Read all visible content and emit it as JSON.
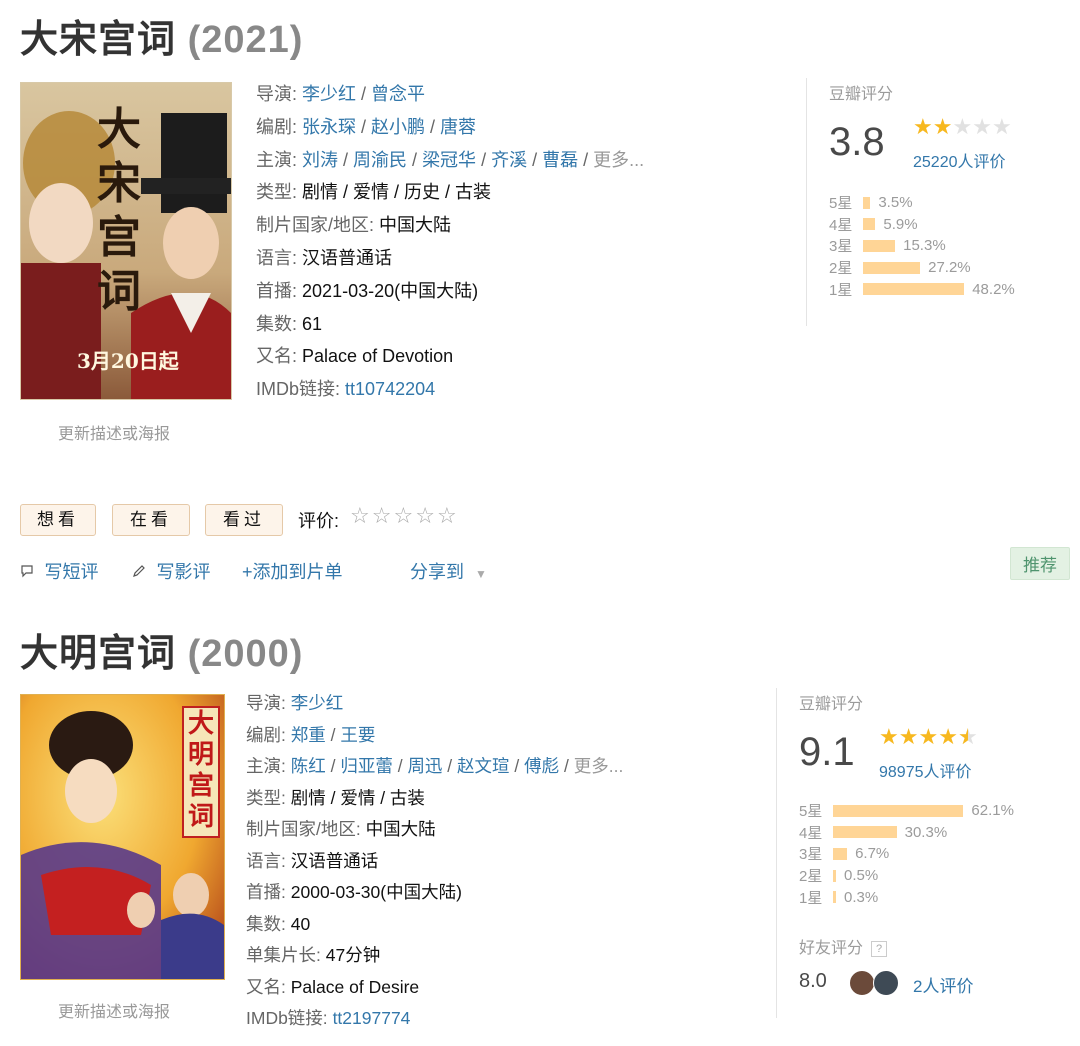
{
  "movies": [
    {
      "title": "大宋宫词",
      "year": "(2021)",
      "poster": {
        "text": "大宋宫词",
        "date": "3月20日起"
      },
      "poster_update": "更新描述或海报",
      "info": {
        "director_label": "导演:",
        "directors": [
          "李少红",
          "曾念平"
        ],
        "writer_label": "编剧:",
        "writers": [
          "张永琛",
          "赵小鹏",
          "唐蓉"
        ],
        "cast_label": "主演:",
        "cast": [
          "刘涛",
          "周渝民",
          "梁冠华",
          "齐溪",
          "曹磊"
        ],
        "more": "更多...",
        "genre_label": "类型:",
        "genre": "剧情 / 爱情 / 历史 / 古装",
        "country_label": "制片国家/地区:",
        "country": "中国大陆",
        "language_label": "语言:",
        "language": "汉语普通话",
        "premiere_label": "首播:",
        "premiere": "2021-03-20(中国大陆)",
        "episodes_label": "集数:",
        "episodes": "61",
        "aka_label": "又名:",
        "aka": "Palace of Devotion",
        "imdb_label": "IMDb链接:",
        "imdb": "tt10742204"
      },
      "rating": {
        "head": "豆瓣评分",
        "score": "3.8",
        "stars_filled": 2,
        "votes": "25220人评价",
        "distribution": [
          {
            "label": "5星",
            "pct": "3.5%",
            "value": 3.5
          },
          {
            "label": "4星",
            "pct": "5.9%",
            "value": 5.9
          },
          {
            "label": "3星",
            "pct": "15.3%",
            "value": 15.3
          },
          {
            "label": "2星",
            "pct": "27.2%",
            "value": 27.2
          },
          {
            "label": "1星",
            "pct": "48.2%",
            "value": 48.2
          }
        ]
      }
    },
    {
      "title": "大明宫词",
      "year": "(2000)",
      "poster": {
        "text": "大明宫词"
      },
      "poster_update": "更新描述或海报",
      "info": {
        "director_label": "导演:",
        "directors": [
          "李少红"
        ],
        "writer_label": "编剧:",
        "writers": [
          "郑重",
          "王要"
        ],
        "cast_label": "主演:",
        "cast": [
          "陈红",
          "归亚蕾",
          "周迅",
          "赵文瑄",
          "傅彪"
        ],
        "more": "更多...",
        "genre_label": "类型:",
        "genre": "剧情 / 爱情 / 古装",
        "country_label": "制片国家/地区:",
        "country": "中国大陆",
        "language_label": "语言:",
        "language": "汉语普通话",
        "premiere_label": "首播:",
        "premiere": "2000-03-30(中国大陆)",
        "episodes_label": "集数:",
        "episodes": "40",
        "runtime_label": "单集片长:",
        "runtime": "47分钟",
        "aka_label": "又名:",
        "aka": "Palace of Desire",
        "imdb_label": "IMDb链接:",
        "imdb": "tt2197774"
      },
      "rating": {
        "head": "豆瓣评分",
        "score": "9.1",
        "stars_filled": 4.5,
        "votes": "98975人评价",
        "distribution": [
          {
            "label": "5星",
            "pct": "62.1%",
            "value": 62.1
          },
          {
            "label": "4星",
            "pct": "30.3%",
            "value": 30.3
          },
          {
            "label": "3星",
            "pct": "6.7%",
            "value": 6.7
          },
          {
            "label": "2星",
            "pct": "0.5%",
            "value": 0.5
          },
          {
            "label": "1星",
            "pct": "0.3%",
            "value": 0.3
          }
        ]
      },
      "friends": {
        "head": "好友评分",
        "help": "?",
        "score": "8.0",
        "votes": "2人评价"
      }
    }
  ],
  "actions": {
    "want": "想看",
    "watching": "在看",
    "watched": "看过",
    "rate_label": "评价:",
    "short_review": "写短评",
    "review": "写影评",
    "add_list": "+添加到片单",
    "share": "分享到",
    "recommend": "推荐"
  },
  "colors": {
    "link": "#3377aa",
    "star": "#f7b81f",
    "bar": "#ffd596",
    "recommend_bg": "#e3f1e3"
  },
  "icons": [
    "comment-icon",
    "pencil-icon",
    "share-arrow-icon",
    "help-icon"
  ]
}
